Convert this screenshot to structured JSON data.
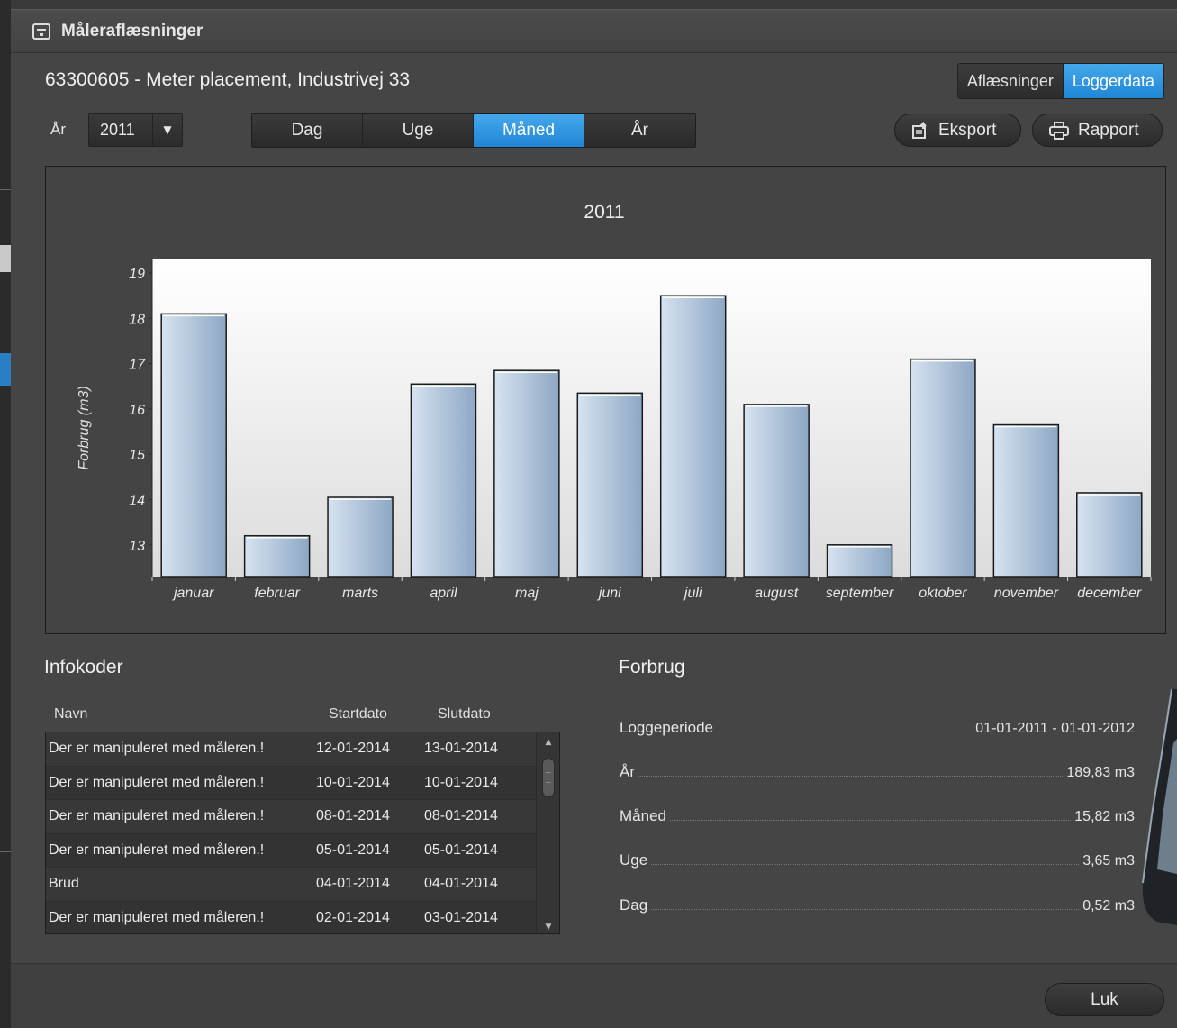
{
  "window": {
    "title": "Måleraflæsninger"
  },
  "header": {
    "title": "63300605 - Meter placement, Industrivej 33"
  },
  "view_toggle": {
    "readings": "Aflæsninger",
    "loggerdata": "Loggerdata",
    "active": "Loggerdata"
  },
  "year_filter": {
    "label": "År",
    "value": "2011"
  },
  "period_tabs": {
    "items": [
      "Dag",
      "Uge",
      "Måned",
      "År"
    ],
    "active": "Måned"
  },
  "actions": {
    "export": "Eksport",
    "report": "Rapport"
  },
  "colors": {
    "accent": "#2a8ddd",
    "bar_light": "#d3e1f0",
    "bar_dark": "#8aa4c0"
  },
  "chart_data": {
    "type": "bar",
    "title": "2011",
    "ylabel": "Forbrug (m3)",
    "xlabel": "",
    "categories": [
      "januar",
      "februar",
      "marts",
      "april",
      "maj",
      "juni",
      "juli",
      "august",
      "september",
      "oktober",
      "november",
      "december"
    ],
    "values": [
      18.1,
      13.2,
      14.05,
      16.55,
      16.85,
      16.35,
      18.5,
      16.1,
      13.0,
      17.1,
      15.65,
      14.15
    ],
    "ylim": [
      12.3,
      19.3
    ],
    "yticks": [
      "13",
      "14",
      "15",
      "16",
      "17",
      "18",
      "19"
    ],
    "grid": false,
    "legend": "none"
  },
  "infokoder": {
    "title": "Infokoder",
    "columns": [
      "Navn",
      "Startdato",
      "Slutdato"
    ],
    "rows": [
      [
        "Der er manipuleret med måleren.!",
        "12-01-2014",
        "13-01-2014"
      ],
      [
        "Der er manipuleret med måleren.!",
        "10-01-2014",
        "10-01-2014"
      ],
      [
        "Der er manipuleret med måleren.!",
        "08-01-2014",
        "08-01-2014"
      ],
      [
        "Der er manipuleret med måleren.!",
        "05-01-2014",
        "05-01-2014"
      ],
      [
        "Brud",
        "04-01-2014",
        "04-01-2014"
      ],
      [
        "Der er manipuleret med måleren.!",
        "02-01-2014",
        "03-01-2014"
      ]
    ]
  },
  "forbrug": {
    "title": "Forbrug",
    "rows": [
      {
        "label": "Loggeperiode",
        "value": "01-01-2011 - 01-01-2012"
      },
      {
        "label": "År",
        "value": "189,83 m3"
      },
      {
        "label": "Måned",
        "value": "15,82 m3"
      },
      {
        "label": "Uge",
        "value": "3,65 m3"
      },
      {
        "label": "Dag",
        "value": "0,52 m3"
      }
    ]
  },
  "footer": {
    "close": "Luk"
  }
}
